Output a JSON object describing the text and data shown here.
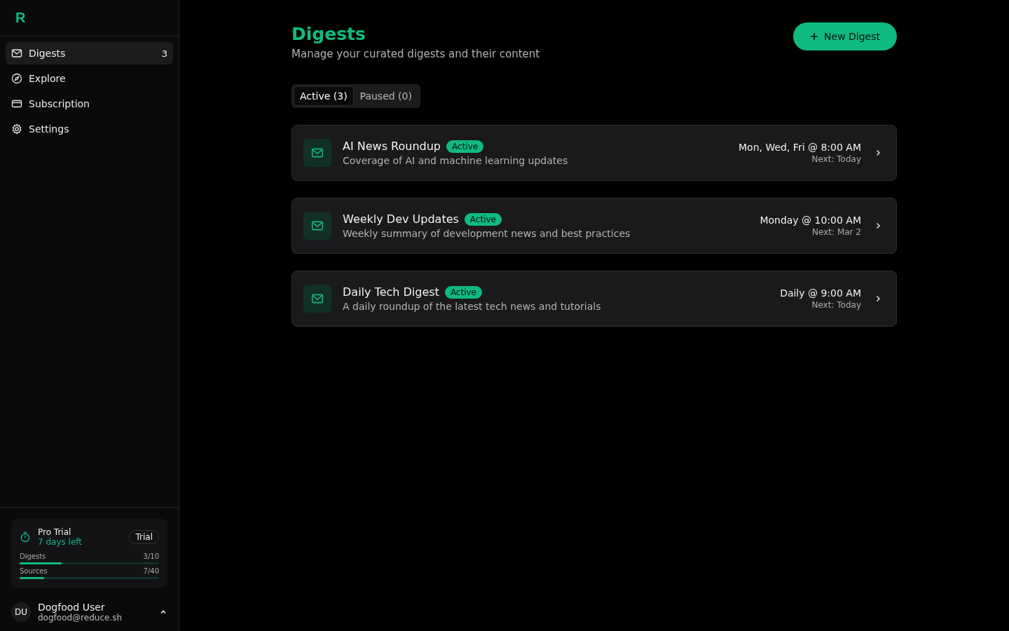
{
  "logo": "R",
  "sidebar": {
    "items": [
      {
        "label": "Digests",
        "count": "3",
        "selected": true
      },
      {
        "label": "Explore",
        "selected": false
      },
      {
        "label": "Subscription",
        "selected": false
      },
      {
        "label": "Settings",
        "selected": false
      }
    ]
  },
  "trial": {
    "title": "Pro Trial",
    "subtitle": "7 days left",
    "badge": "Trial",
    "meters": [
      {
        "label": "Digests",
        "reading": "3/10",
        "level": 0.3
      },
      {
        "label": "Sources",
        "reading": "7/40",
        "level": 0.175
      }
    ]
  },
  "user": {
    "initials": "DU",
    "name": "Dogfood User",
    "email": "dogfood@reduce.sh"
  },
  "header": {
    "title": "Digests",
    "subtitle": "Manage your curated digests and their content",
    "button": "New Digest"
  },
  "tabs": [
    {
      "label": "Active (3)",
      "selected": true
    },
    {
      "label": "Paused (0)",
      "selected": false
    }
  ],
  "digests": [
    {
      "name": "AI News Roundup",
      "status": "Active",
      "description": "Coverage of AI and machine learning updates",
      "schedule": "Mon, Wed, Fri @ 8:00 AM",
      "next": "Next: Today"
    },
    {
      "name": "Weekly Dev Updates",
      "status": "Active",
      "description": "Weekly summary of development news and best practices",
      "schedule": "Monday @ 10:00 AM",
      "next": "Next: Mar 2"
    },
    {
      "name": "Daily Tech Digest",
      "status": "Active",
      "description": "A daily roundup of the latest tech news and tutorials",
      "schedule": "Daily @ 9:00 AM",
      "next": "Next: Today"
    }
  ]
}
